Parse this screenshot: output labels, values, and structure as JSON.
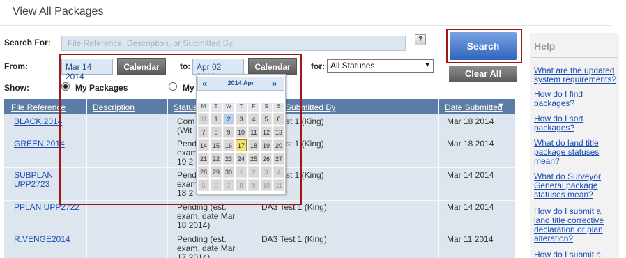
{
  "page": {
    "title": "View All Packages"
  },
  "search": {
    "label": "Search For:",
    "placeholder": "File Reference, Description, or Submitted By",
    "help_icon": "?"
  },
  "filters": {
    "from_label": "From:",
    "from_value": "Mar 14 2014",
    "to_label": "to:",
    "to_value": "Apr 02 2014",
    "calendar_button": "Calendar",
    "for_label": "for:",
    "status_value": "All Statuses",
    "show_label": "Show:",
    "my_packages": "My Packages",
    "other_option": "My"
  },
  "buttons": {
    "search": "Search",
    "clear_all": "Clear All"
  },
  "help": {
    "title": "Help",
    "links": [
      "What are the updated system requirements?",
      "How do I find packages?",
      "How do I sort packages?",
      "What do land title package statuses mean?",
      "What do Surveyor General package statuses mean?",
      "How do I submit a land title corrective declaration or plan alteration?",
      "How do I submit a"
    ]
  },
  "table": {
    "headers": {
      "file_reference": "File Reference",
      "description": "Description",
      "status": "Status",
      "submitted_by": "Submitted By",
      "date_submitted": "Date Submitted",
      "sort_icon": "▼"
    },
    "rows": [
      {
        "ref": "BLACK.2014",
        "status": "Com (Wit",
        "submitted_by": "st 1 (King)",
        "date": "Mar 18 2014"
      },
      {
        "ref": "GREEN.2014",
        "status": "Pend exam 19 2",
        "submitted_by": "st 1 (King)",
        "date": "Mar 18 2014"
      },
      {
        "ref": "SUBPLAN UPP2723",
        "status": "Pend exam 18 2",
        "submitted_by": "st 1 (King)",
        "date": "Mar 14 2014"
      },
      {
        "ref": "PPLAN UPP2722",
        "status": "Pending (est. exam. date Mar 18 2014)",
        "submitted_by": "DA3 Test 1 (King)",
        "date": "Mar 14 2014"
      },
      {
        "ref": "R.VENGE2014",
        "status": "Pending (est. exam. date Mar 17 2014)",
        "submitted_by": "DA3 Test 1 (King)",
        "date": "Mar 11 2014"
      }
    ]
  },
  "calendar": {
    "prev": "«",
    "next": "»",
    "month_label": "2014 Apr",
    "weekdays": [
      "M",
      "T",
      "W",
      "T",
      "F",
      "S",
      "S"
    ],
    "weeks": [
      [
        "31",
        "1",
        "2",
        "3",
        "4",
        "5",
        "6"
      ],
      [
        "7",
        "8",
        "9",
        "10",
        "11",
        "12",
        "13"
      ],
      [
        "14",
        "15",
        "16",
        "17",
        "18",
        "19",
        "20"
      ],
      [
        "21",
        "22",
        "23",
        "24",
        "25",
        "26",
        "27"
      ],
      [
        "28",
        "29",
        "30",
        "1",
        "2",
        "3",
        "4"
      ],
      [
        "5",
        "6",
        "7",
        "8",
        "9",
        "10",
        "11"
      ]
    ],
    "selected_day": "2",
    "today": "17"
  },
  "colors": {
    "accent_blue": "#2f64bf",
    "header_bg": "#5b7ca6",
    "highlight_red": "#a31616",
    "today_yellow": "#f1e06a"
  }
}
